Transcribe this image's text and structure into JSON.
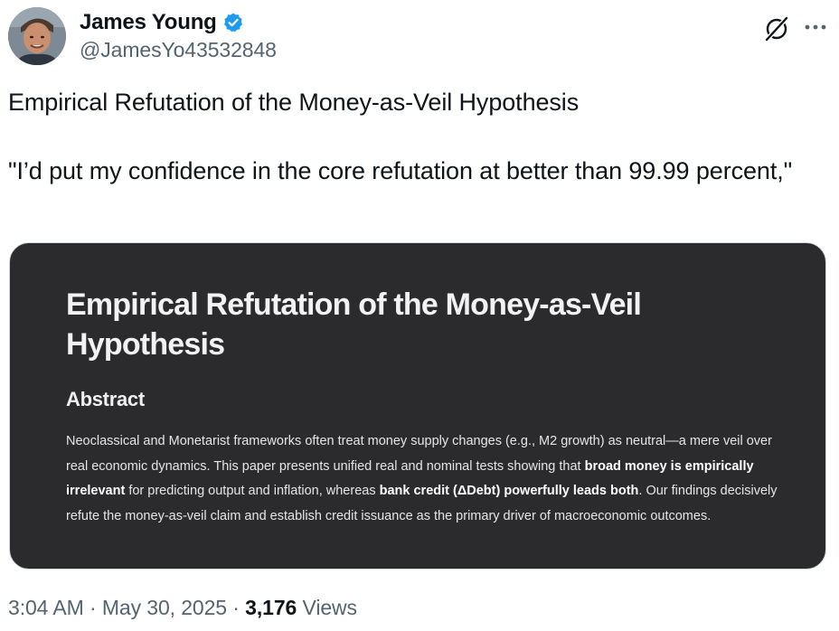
{
  "author": {
    "display_name": "James Young",
    "handle": "@JamesYo43532848",
    "avatar_icon": "profile-photo",
    "verified_icon": "verified-badge-icon",
    "verified_color": "#1d9bf0"
  },
  "header_actions": {
    "grok_icon": "grok-icon",
    "more_icon": "more-options-icon"
  },
  "tweet": {
    "line1": "Empirical Refutation of the Money-as-Veil Hypothesis",
    "line2": "\"I’d put my confidence in the core refutation at better than 99.99 percent,\""
  },
  "media": {
    "title": "Empirical Refutation of the Money-as-Veil Hypothesis",
    "subheading": "Abstract",
    "abstract": {
      "part1": "Neoclassical and Monetarist frameworks often treat money supply changes (e.g., M2 growth) as neutral—a mere veil over real economic dynamics. This paper presents unified real and nominal tests showing that ",
      "bold1": "broad money is empirically irrelevant",
      "part2": " for predicting output and inflation, whereas ",
      "bold2": "bank credit (ΔDebt) powerfully leads both",
      "part3": ". Our findings decisively refute the money-as-veil claim and establish credit issuance as the primary driver of macroeconomic outcomes."
    }
  },
  "meta": {
    "time": "3:04 AM",
    "separator1": " · ",
    "date": "May 30, 2025",
    "separator2": " · ",
    "view_count": "3,176",
    "views_label": " Views"
  }
}
